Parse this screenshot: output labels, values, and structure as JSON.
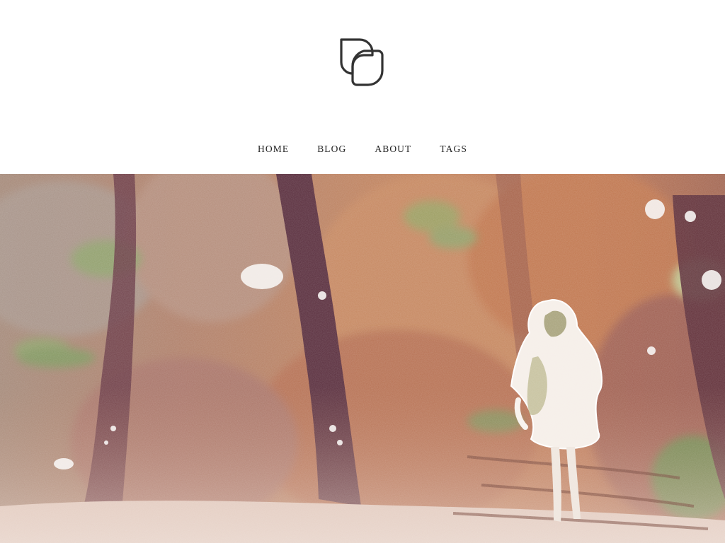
{
  "header": {
    "logo": {
      "icon": "overlapping-rounded-squares-icon",
      "color": "#333333"
    }
  },
  "nav": {
    "items": [
      {
        "label": "HOME"
      },
      {
        "label": "BLOG"
      },
      {
        "label": "ABOUT"
      },
      {
        "label": "TAGS"
      }
    ]
  },
  "hero": {
    "icon": "watercolor-forest-walking-figure-illustration",
    "palette": {
      "sky": "#c99a7a",
      "warm": "#c07a54",
      "deep": "#9b5a44",
      "trunk": "#5a2f3e",
      "foliage": "#8a9a62",
      "path": "#efe3dc",
      "figure": "#f6f0ea"
    }
  }
}
